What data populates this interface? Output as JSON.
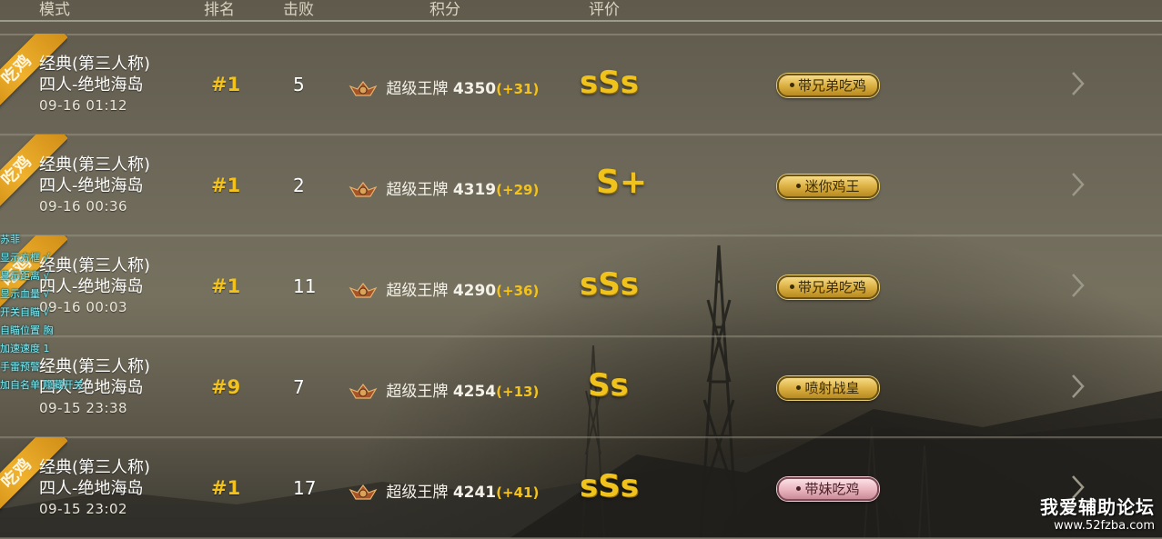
{
  "header": {
    "col_mode": "模式",
    "col_rank": "排名",
    "col_kills": "击败",
    "col_score": "积分",
    "col_rating": "评价"
  },
  "rows": [
    {
      "ribbon": "吃鸡",
      "mode": "经典(第三人称)",
      "map": "四人-绝地海岛",
      "date": "09-16 01:12",
      "rank": "#1",
      "kills": "5",
      "tier": "超级王牌",
      "score": "4350",
      "delta": "(+31)",
      "grade": "sSs",
      "tag": "带兄弟吃鸡",
      "tag_style": "gold"
    },
    {
      "ribbon": "吃鸡",
      "mode": "经典(第三人称)",
      "map": "四人-绝地海岛",
      "date": "09-16 00:36",
      "rank": "#1",
      "kills": "2",
      "tier": "超级王牌",
      "score": "4319",
      "delta": "(+29)",
      "grade": "S+",
      "tag": "迷你鸡王",
      "tag_style": "gold"
    },
    {
      "ribbon": "吃鸡",
      "mode": "经典(第三人称)",
      "map": "四人-绝地海岛",
      "date": "09-16 00:03",
      "rank": "#1",
      "kills": "11",
      "tier": "超级王牌",
      "score": "4290",
      "delta": "(+36)",
      "grade": "sSs",
      "tag": "带兄弟吃鸡",
      "tag_style": "gold"
    },
    {
      "ribbon": "",
      "mode": "经典(第三人称)",
      "map": "四人-绝地海岛",
      "date": "09-15 23:38",
      "rank": "#9",
      "kills": "7",
      "tier": "超级王牌",
      "score": "4254",
      "delta": "(+13)",
      "grade": "Ss",
      "tag": "喷射战皇",
      "tag_style": "gold"
    },
    {
      "ribbon": "吃鸡",
      "mode": "经典(第三人称)",
      "map": "四人-绝地海岛",
      "date": "09-15 23:02",
      "rank": "#1",
      "kills": "17",
      "tier": "超级王牌",
      "score": "4241",
      "delta": "(+41)",
      "grade": "sSs",
      "tag": "带妹吃鸡",
      "tag_style": "pink"
    }
  ],
  "overlay_menu": [
    "苏菲",
    "显示方框 √",
    "显示距离 √",
    "显示血量 √",
    "开关自瞄 √",
    "自瞄位置 胸",
    "加速速度 1",
    "手雷预警",
    "加自名单 隐藏开关"
  ],
  "watermark": {
    "line1": "我爱辅助论坛",
    "line2": "www.52fzba.com"
  },
  "colors": {
    "accent_gold": "#f3c31c",
    "ribbon_orange": "#f0b12d",
    "cheat_text": "#7ff0f6"
  }
}
